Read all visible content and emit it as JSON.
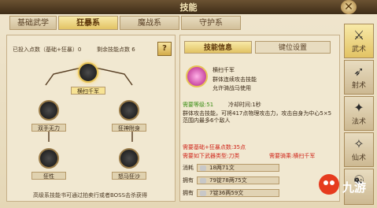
{
  "window": {
    "title": "技能",
    "close_icon": "close-icon"
  },
  "tabs": [
    {
      "label": "基础武学"
    },
    {
      "label": "狂暴系"
    },
    {
      "label": "魔战系"
    },
    {
      "label": "守护系"
    }
  ],
  "left": {
    "invested_label": "已投入点数（基础+狂暴）0",
    "remaining_label": "剩余技能点数 6",
    "help": "?",
    "nodes": [
      {
        "label": "横扫千军"
      },
      {
        "label": "双手无力"
      },
      {
        "label": "狂神附身"
      },
      {
        "label": "狂性"
      },
      {
        "label": "怒马狂沙"
      }
    ],
    "footer": "高级系技能书可通过拍卖行或者BOSS击杀获得"
  },
  "right": {
    "tabs": [
      {
        "label": "技能信息"
      },
      {
        "label": "键位设置"
      }
    ],
    "skill_name": "横扫千军",
    "skill_desc_1": "群体连续攻击技能",
    "skill_desc_2": "允许骑战马使用",
    "req_level": "需要等级:51",
    "cooldown": "冷却时间:1秒",
    "description": "群体攻击技能，可将417点物理攻击力，攻击自身为中心5×5范围内最多6个敌人",
    "req_points": "需要基础+狂暴点数:35点",
    "req_skill": "需要如下武器类型:刀类",
    "req_mount": "需要骑乘:横扫千军",
    "cost_rows": [
      {
        "label": "消耗",
        "value": "18两71文"
      },
      {
        "label": "拥有",
        "value": "79锭78两75文"
      },
      {
        "label": "拥有",
        "value": "7锭36两59文"
      }
    ]
  },
  "side": [
    {
      "label": "武术",
      "icon": "martial-icon"
    },
    {
      "label": "射术",
      "icon": "archery-icon"
    },
    {
      "label": "法术",
      "icon": "magic-icon"
    },
    {
      "label": "仙术",
      "icon": "immortal-icon"
    },
    {
      "label": "",
      "icon": "misc-icon"
    }
  ],
  "watermark": {
    "text": "九游"
  }
}
